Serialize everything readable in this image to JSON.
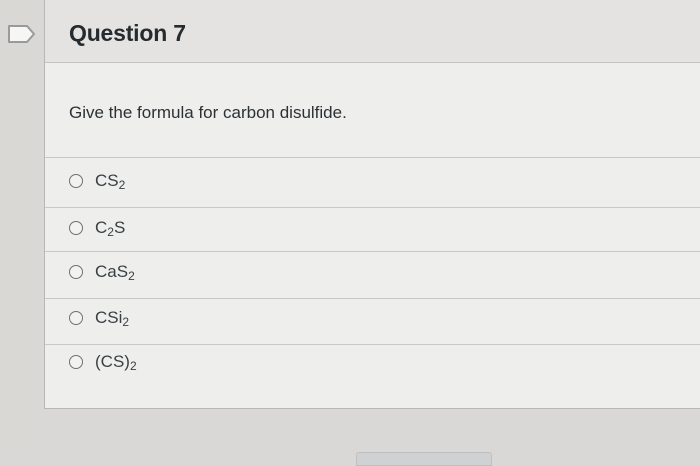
{
  "question": {
    "title": "Question 7",
    "prompt": "Give the formula for carbon disulfide."
  },
  "answers": [
    {
      "base": "CS",
      "sub": "2",
      "tail": "",
      "selected": false
    },
    {
      "base": "C",
      "sub": "2",
      "tail": "S",
      "selected": false
    },
    {
      "base": "CaS",
      "sub": "2",
      "tail": "",
      "selected": false
    },
    {
      "base": "CSi",
      "sub": "2",
      "tail": "",
      "selected": false
    },
    {
      "base": "(CS)",
      "sub": "2",
      "tail": "",
      "selected": false
    }
  ],
  "icons": {
    "flag": "flag-icon"
  },
  "colors": {
    "background": "#eeeeec",
    "header": "#e4e3e1",
    "text": "#2c3136"
  }
}
